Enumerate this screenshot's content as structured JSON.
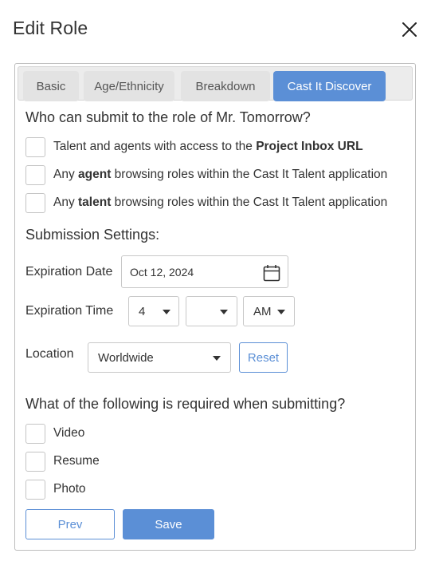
{
  "dialog": {
    "title": "Edit Role"
  },
  "tabs": [
    {
      "label": "Basic"
    },
    {
      "label": "Age/Ethnicity"
    },
    {
      "label": "Breakdown"
    },
    {
      "label": "Cast It Discover",
      "active": true
    }
  ],
  "who": {
    "question": "Who can submit to the role of Mr. Tomorrow?",
    "options": [
      {
        "pre": "Talent and agents with access to the ",
        "bold": "Project Inbox URL",
        "post": ""
      },
      {
        "pre": "Any ",
        "bold": "agent",
        "post": " browsing roles within the Cast It Talent application"
      },
      {
        "pre": "Any ",
        "bold": "talent",
        "post": " browsing roles within the Cast It Talent application"
      }
    ]
  },
  "settings": {
    "heading": "Submission Settings:",
    "expiration_date_label": "Expiration Date",
    "expiration_date_value": "Oct 12, 2024",
    "expiration_time_label": "Expiration Time",
    "hour": "4",
    "minute": "",
    "ampm": "AM",
    "location_label": "Location",
    "location_value": "Worldwide",
    "reset_label": "Reset"
  },
  "required": {
    "question": "What of the following is required when submitting?",
    "options": [
      "Video",
      "Resume",
      "Photo"
    ]
  },
  "footer": {
    "prev_label": "Prev",
    "save_label": "Save"
  },
  "colors": {
    "accent": "#5b8fd6",
    "tab_bg": "#ececec",
    "border": "#c8c8c8"
  }
}
